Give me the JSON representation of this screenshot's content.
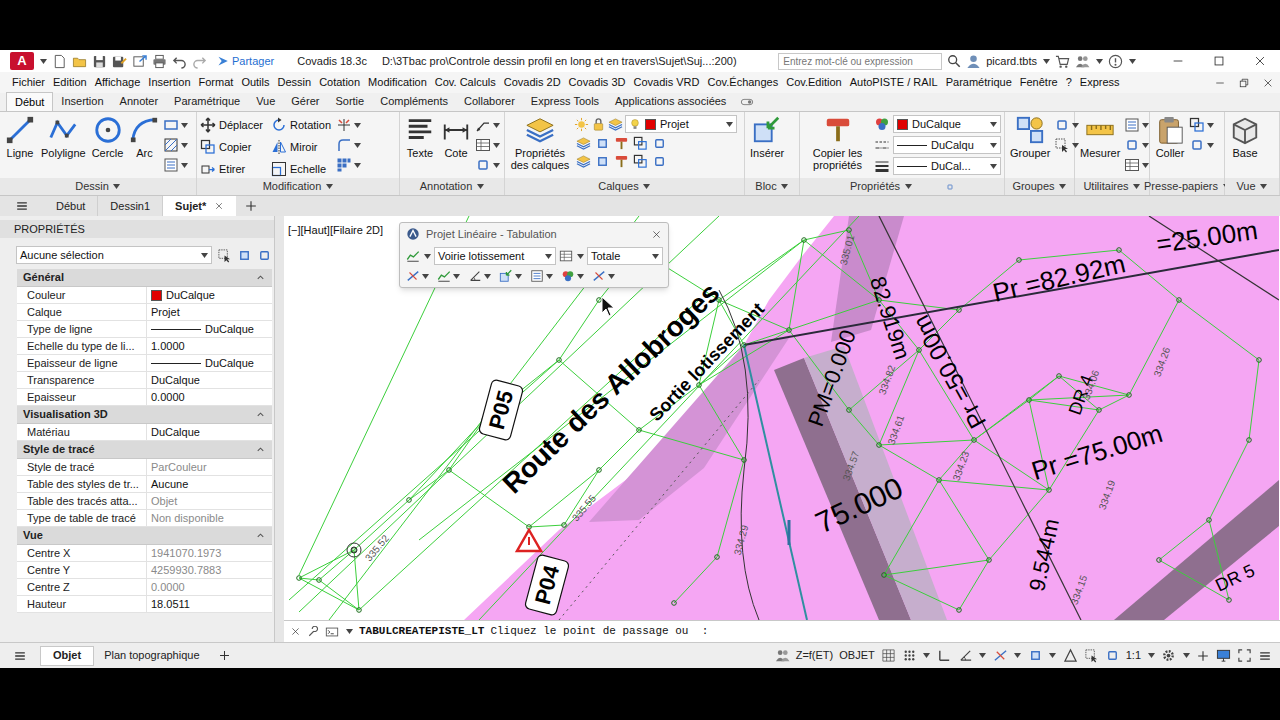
{
  "app": {
    "logo": "A",
    "share": "Partager",
    "title": "Covadis 18.3c",
    "path": "D:\\3Tbac pro\\Controle dessin profil en long et en travers\\Sujet\\Suj...:200)",
    "search": {
      "placeholder": "Entrez mot-clé ou expression"
    },
    "user": "picard.tbts"
  },
  "menu_bar": [
    "Fichier",
    "Edition",
    "Affichage",
    "Insertion",
    "Format",
    "Outils",
    "Dessin",
    "Cotation",
    "Modification",
    "Cov. Calculs",
    "Covadis 2D",
    "Covadis 3D",
    "Covadis VRD",
    "Cov.Échanges",
    "Cov.Edition",
    "AutoPISTE / RAIL",
    "Paramétrique",
    "Fenêtre",
    "?",
    "Express"
  ],
  "ribbon_tabs": [
    {
      "label": "Début",
      "selected": true
    },
    {
      "label": "Insertion",
      "selected": false
    },
    {
      "label": "Annoter",
      "selected": false
    },
    {
      "label": "Paramétrique",
      "selected": false
    },
    {
      "label": "Vue",
      "selected": false
    },
    {
      "label": "Gérer",
      "selected": false
    },
    {
      "label": "Sortie",
      "selected": false
    },
    {
      "label": "Compléments",
      "selected": false
    },
    {
      "label": "Collaborer",
      "selected": false
    },
    {
      "label": "Express Tools",
      "selected": false
    },
    {
      "label": "Applications associées",
      "selected": false
    }
  ],
  "ribbon": {
    "dessin": {
      "title": "Dessin",
      "tools": [
        "Ligne",
        "Polyligne",
        "Cercle",
        "Arc"
      ]
    },
    "modification": {
      "title": "Modification",
      "tools": [
        "Déplacer",
        "Rotation",
        "Copier",
        "Miroir",
        "Etirer",
        "Echelle"
      ]
    },
    "annotation": {
      "title": "Annotation",
      "tools": [
        "Texte",
        "Cote"
      ]
    },
    "calques": {
      "title": "Calques",
      "tool": "Propriétés des calques",
      "layer": "Projet",
      "layer_color": "#e00000"
    },
    "bloc": {
      "title": "Bloc",
      "tool": "Insérer"
    },
    "proprietes": {
      "title": "Propriétés",
      "tool": "Copier les propriétés",
      "color": "DuCalque",
      "color_swatch": "#e00000",
      "linetype": "DuCalqu",
      "lineweight": "DuCal..."
    },
    "groupes": {
      "title": "Groupes",
      "tool": "Grouper"
    },
    "utilitaires": {
      "title": "Utilitaires",
      "tool": "Mesurer"
    },
    "presse_papiers": {
      "title": "Presse-papiers",
      "tool": "Coller"
    },
    "vue": {
      "title": "Vue",
      "tool": "Base"
    }
  },
  "doc_tabs": [
    {
      "label": "Début",
      "selected": false
    },
    {
      "label": "Dessin1",
      "selected": false
    },
    {
      "label": "Sujet*",
      "selected": true
    }
  ],
  "properties": {
    "title": "PROPRIÉTÉS",
    "selection": "Aucune sélection",
    "sections": [
      {
        "title": "Général",
        "expanded": true,
        "rows": [
          {
            "label": "Couleur",
            "value": "DuCalque",
            "kind": "color",
            "color": "#e00000",
            "disabled": false
          },
          {
            "label": "Calque",
            "value": "Projet",
            "kind": "text",
            "disabled": false
          },
          {
            "label": "Type de ligne",
            "value": "DuCalque",
            "kind": "line",
            "disabled": false
          },
          {
            "label": "Echelle du type de li...",
            "value": "1.0000",
            "kind": "text",
            "disabled": false
          },
          {
            "label": "Epaisseur de ligne",
            "value": "DuCalque",
            "kind": "line",
            "disabled": false
          },
          {
            "label": "Transparence",
            "value": "DuCalque",
            "kind": "text",
            "disabled": false
          },
          {
            "label": "Epaisseur",
            "value": "0.0000",
            "kind": "text",
            "disabled": false
          }
        ]
      },
      {
        "title": "Visualisation 3D",
        "expanded": true,
        "rows": [
          {
            "label": "Matériau",
            "value": "DuCalque",
            "kind": "text",
            "disabled": false
          }
        ]
      },
      {
        "title": "Style de tracé",
        "expanded": true,
        "rows": [
          {
            "label": "Style de tracé",
            "value": "ParCouleur",
            "kind": "text",
            "disabled": true
          },
          {
            "label": "Table des styles de tr...",
            "value": "Aucune",
            "kind": "text",
            "disabled": false
          },
          {
            "label": "Table des tracés atta...",
            "value": "Objet",
            "kind": "text",
            "disabled": true
          },
          {
            "label": "Type de table de tracé",
            "value": "Non disponible",
            "kind": "text",
            "disabled": true
          }
        ]
      },
      {
        "title": "Vue",
        "expanded": true,
        "rows": [
          {
            "label": "Centre X",
            "value": "1941070.1973",
            "kind": "text",
            "disabled": true
          },
          {
            "label": "Centre Y",
            "value": "4259930.7883",
            "kind": "text",
            "disabled": true
          },
          {
            "label": "Centre Z",
            "value": "0.0000",
            "kind": "text",
            "disabled": true
          },
          {
            "label": "Hauteur",
            "value": "18.0511",
            "kind": "text",
            "disabled": false
          }
        ]
      }
    ]
  },
  "viewport": {
    "label": "[−][Haut][Filaire 2D]"
  },
  "floating_toolbar": {
    "title": "Projet Linéaire - Tabulation",
    "profile": "Voirie lotissement",
    "mode": "Totale"
  },
  "canvas": {
    "labels": [
      "Route des Allobroges",
      "Sortie lotissement",
      "P05",
      "P04",
      "Pr =82.92m",
      "Pr =75.00m",
      "Pr =50.00m",
      "PM=0.000",
      "82.919m",
      "75.000",
      "9.544m",
      "=25.00m",
      "DR 4",
      "DR 5",
      "334.06",
      "334.61",
      "334.23",
      "334.57",
      "334.82",
      "335.55",
      "335.52",
      "334.29",
      "334.19",
      "334.15",
      "334.26",
      "335.01"
    ]
  },
  "command_line": {
    "command": "TABULCREATEPISTE_LT",
    "prompt": "Cliquez le point de passage ou  :"
  },
  "layout_tabs": [
    {
      "label": "Objet",
      "selected": true
    },
    {
      "label": "Plan topographique",
      "selected": false
    }
  ],
  "status_bar": {
    "z": "Z=f(ET)",
    "mode": "OBJET",
    "scale": "1:1"
  }
}
